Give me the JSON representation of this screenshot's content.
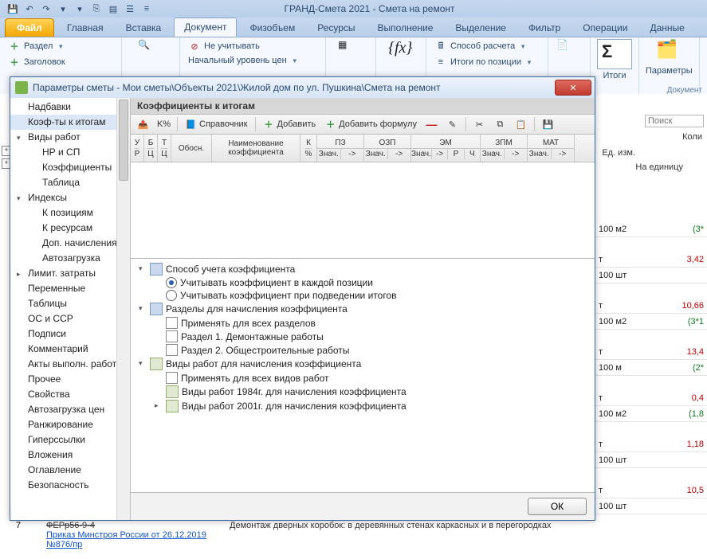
{
  "app_title": "ГРАНД-Смета 2021 - Смета на ремонт",
  "tabs_file": "Файл",
  "ribbon_tabs": [
    "Главная",
    "Вставка",
    "Документ",
    "Физобъем",
    "Ресурсы",
    "Выполнение",
    "Выделение",
    "Фильтр",
    "Операции",
    "Данные"
  ],
  "ribbon": {
    "razdel": "Раздел",
    "zagolovok": "Заголовок",
    "ne_uchityvat": "Не учитывать",
    "nach_uroven": "Начальный уровень цен",
    "sposob": "Способ расчета",
    "itogi_poz": "Итоги по позиции",
    "itogi": "Итоги",
    "parametry": "Параметры",
    "dokument_grp": "Документ"
  },
  "dialog": {
    "title": "Параметры сметы - Мои сметы\\Объекты 2021\\Жилой дом по ул. Пушкина\\Смета на ремонт",
    "tree": [
      {
        "label": "Надбавки",
        "lvl": 1
      },
      {
        "label": "Коэф-ты к итогам",
        "lvl": 1,
        "sel": true
      },
      {
        "label": "Виды работ",
        "lvl": 1,
        "exp": "▾"
      },
      {
        "label": "НР и СП",
        "lvl": 2
      },
      {
        "label": "Коэффициенты",
        "lvl": 2
      },
      {
        "label": "Таблица",
        "lvl": 2
      },
      {
        "label": "Индексы",
        "lvl": 1,
        "exp": "▾"
      },
      {
        "label": "К позициям",
        "lvl": 2
      },
      {
        "label": "К ресурсам",
        "lvl": 2
      },
      {
        "label": "Доп. начисления",
        "lvl": 2
      },
      {
        "label": "Автозагрузка",
        "lvl": 2
      },
      {
        "label": "Лимит. затраты",
        "lvl": 1,
        "exp": "▸"
      },
      {
        "label": "Переменные",
        "lvl": 1
      },
      {
        "label": "Таблицы",
        "lvl": 1
      },
      {
        "label": "ОС и ССР",
        "lvl": 1
      },
      {
        "label": "Подписи",
        "lvl": 1
      },
      {
        "label": "Комментарий",
        "lvl": 1
      },
      {
        "label": "Акты выполн. работ",
        "lvl": 1
      },
      {
        "label": "Прочее",
        "lvl": 1
      },
      {
        "label": "Свойства",
        "lvl": 1
      },
      {
        "label": "Автозагрузка цен",
        "lvl": 1
      },
      {
        "label": "Ранжирование",
        "lvl": 1
      },
      {
        "label": "Гиперссылки",
        "lvl": 1
      },
      {
        "label": "Вложения",
        "lvl": 1
      },
      {
        "label": "Оглавление",
        "lvl": 1
      },
      {
        "label": "Безопасность",
        "lvl": 1
      }
    ],
    "section_title": "Коэффициенты к итогам",
    "tb": {
      "spravochnik": "Справочник",
      "dobavit": "Добавить",
      "dob_formula": "Добавить формулу"
    },
    "headers": {
      "ur": "У\nР",
      "bc": "Б\nЦ",
      "tc": "Т\nЦ",
      "obosn": "Обосн.",
      "naim": "Наименование коэффициента",
      "kperc": "К\n%",
      "pz": "ПЗ",
      "ozp": "ОЗП",
      "em": "ЭМ",
      "zpm": "ЗПМ",
      "mat": "МАТ",
      "znach": "Знач.",
      "arrow": "->",
      "r": "Р",
      "ch": "Ч"
    },
    "lower": {
      "g1": "Способ учета коэффициента",
      "g1a": "Учитывать коэффициент в каждой позиции",
      "g1b": "Учитывать коэффициент при подведении итогов",
      "g2": "Разделы для начисления коэффициента",
      "g2a": "Применять для всех разделов",
      "g2b": "Раздел 1. Демонтажные работы",
      "g2c": "Раздел 2. Общестроительные работы",
      "g3": "Виды работ для начисления коэффициента",
      "g3a": "Применять для всех видов работ",
      "g3b": "Виды работ 1984г. для начисления коэффициента",
      "g3c": "Виды работ 2001г. для начисления коэффициента"
    },
    "ok": "ОК"
  },
  "ws": {
    "search_ph": "Поиск",
    "eizm": "Ед. изм.",
    "koli": "Коли",
    "naed": "На единицу",
    "rows": [
      {
        "u": "100 м2",
        "v": "(3*",
        "cls": "green"
      },
      {
        "u": "т",
        "v": "3,42",
        "cls": "red",
        "sep": true
      },
      {
        "u": "100 шт",
        "v": ""
      },
      {
        "u": "т",
        "v": "10,66",
        "cls": "red",
        "sep": true
      },
      {
        "u": "100 м2",
        "v": "(3*1",
        "cls": "green"
      },
      {
        "u": "т",
        "v": "13,4",
        "cls": "red",
        "sep": true
      },
      {
        "u": "100 м",
        "v": "(2*",
        "cls": "green"
      },
      {
        "u": "т",
        "v": "0,4",
        "cls": "red",
        "sep": true
      },
      {
        "u": "100 м2",
        "v": "(1,8",
        "cls": "green"
      },
      {
        "u": "т",
        "v": "1,18",
        "cls": "red",
        "sep": true
      },
      {
        "u": "100 шт",
        "v": ""
      },
      {
        "u": "т",
        "v": "10,5",
        "cls": "red",
        "sep": true
      },
      {
        "u": "100 шт",
        "v": ""
      }
    ]
  },
  "bg_row": {
    "n": "7",
    "code": "ФЕРр56-9-4",
    "order": "Приказ Минстроя России от 26.12.2019 №876/пр",
    "desc": "Демонтаж дверных коробок: в деревянных стенах каркасных и в перегородках"
  }
}
